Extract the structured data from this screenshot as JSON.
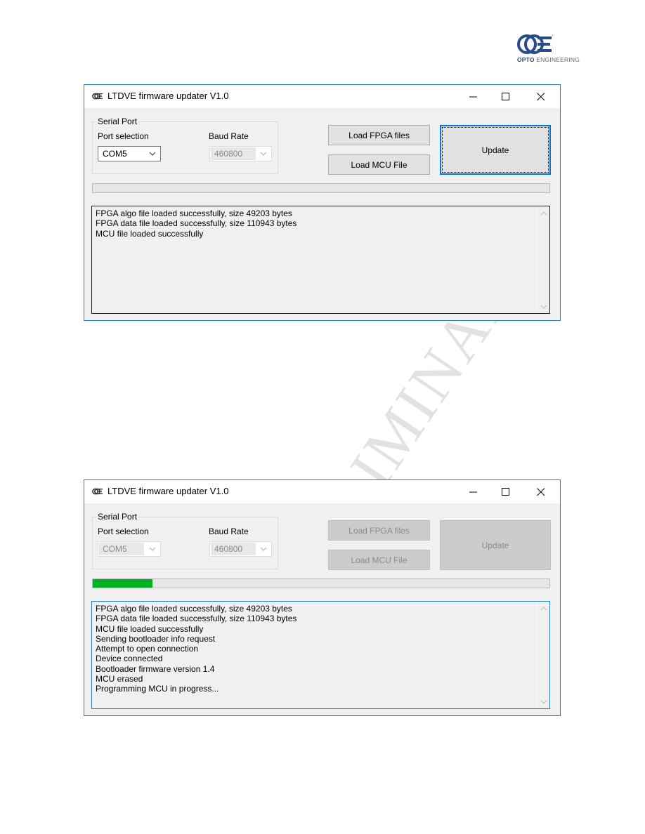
{
  "logo": {
    "brand_bold": "OPTO",
    "brand_rest": " ENGINEERING",
    "icon": "opto-engineering-logo"
  },
  "watermark": "PRELIMINARY",
  "windows": [
    {
      "title": "LTDVE firmware updater V1.0",
      "app_icon": "oe-logo-icon",
      "controls": {
        "minimize": "minimize-icon",
        "maximize": "maximize-icon",
        "close": "close-icon"
      },
      "serial_port": {
        "group_label": "Serial Port",
        "port_label": "Port selection",
        "port_value": "COM5",
        "port_enabled": true,
        "baud_label": "Baud Rate",
        "baud_value": "460800",
        "baud_enabled": false
      },
      "buttons": {
        "load_fpga": "Load FPGA files",
        "load_mcu": "Load MCU File",
        "update": "Update",
        "enabled": true
      },
      "progress_percent": 0,
      "log": [
        "FPGA algo file loaded successfully, size 49203 bytes",
        "FPGA data file loaded successfully, size 110943 bytes",
        "MCU file loaded successfully"
      ]
    },
    {
      "title": "LTDVE firmware updater V1.0",
      "app_icon": "oe-logo-icon",
      "controls": {
        "minimize": "minimize-icon",
        "maximize": "maximize-icon",
        "close": "close-icon"
      },
      "serial_port": {
        "group_label": "Serial Port",
        "port_label": "Port selection",
        "port_value": "COM5",
        "port_enabled": false,
        "baud_label": "Baud Rate",
        "baud_value": "460800",
        "baud_enabled": false
      },
      "buttons": {
        "load_fpga": "Load FPGA files",
        "load_mcu": "Load MCU File",
        "update": "Update",
        "enabled": false
      },
      "progress_percent": 13,
      "log": [
        "FPGA algo file loaded successfully, size 49203 bytes",
        "FPGA data file loaded successfully, size 110943 bytes",
        "MCU file loaded successfully",
        "Sending bootloader info request",
        "Attempt to open connection",
        "Device connected",
        "Bootloader firmware version 1.4",
        "MCU erased",
        "Programming MCU in progress..."
      ]
    }
  ]
}
